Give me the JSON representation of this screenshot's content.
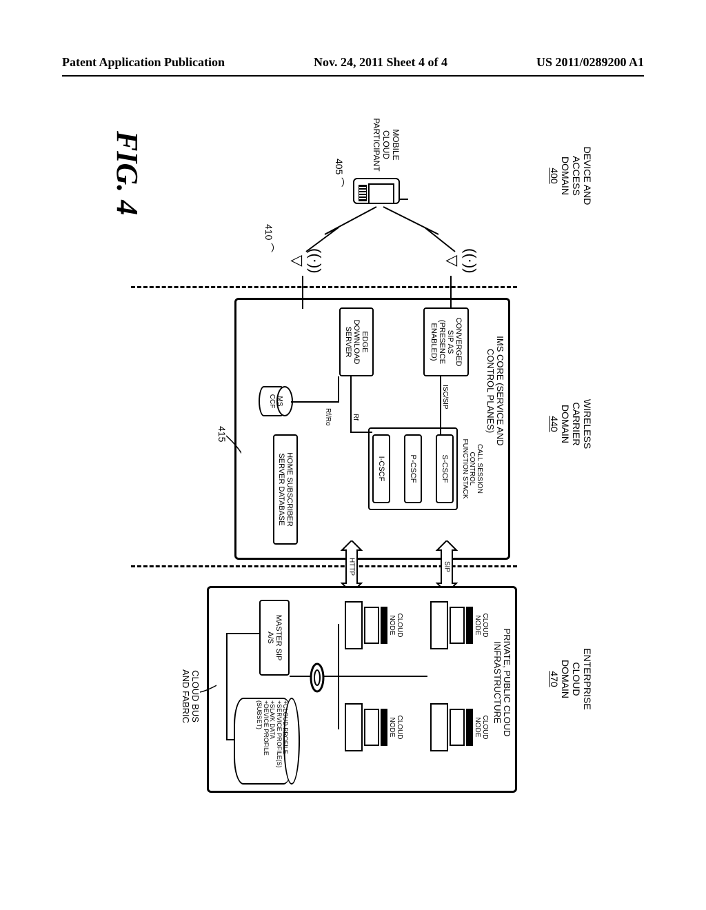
{
  "header": {
    "left": "Patent Application Publication",
    "center": "Nov. 24, 2011  Sheet 4 of 4",
    "right": "US 2011/0289200 A1"
  },
  "figure_label": "FIG. 4",
  "domains": {
    "device": {
      "title": "DEVICE AND\nACCESS\nDOMAIN",
      "ref": "400"
    },
    "carrier": {
      "title": "WIRELESS\nCARRIER\nDOMAIN",
      "ref": "440"
    },
    "enterprise": {
      "title": "ENTERPRISE\nCLOUD\nDOMAIN",
      "ref": "470"
    }
  },
  "device_domain": {
    "participant_label": "MOBILE\nCLOUD\nPARTICIPANT",
    "phone_ref": "405",
    "tower_ref": "410",
    "carrier_ref": "415"
  },
  "carrier_domain": {
    "panel_title": "IMS CORE (SERVICE AND\nCONTROL PLANES)",
    "converged": "CONVERGED\nSIP AS\n(PRESENCE\nENABLED)",
    "edge": "EDGE\nDOWNLOAD\nSERVER",
    "callstack_title": "CALL SESSION\nCONTROL\nFUNCTION STACK",
    "scscf": "S-CSCF",
    "pcscf": "P-CSCF",
    "icscf": "I-CSCF",
    "hss": "HOME SUBSCRIBER\nSERVER DATABASE",
    "msccf": "MS\nCCF",
    "isc": "ISC/SIP",
    "rf": "Rf",
    "rfro": "Rf/Ro"
  },
  "interarrows": {
    "sip": "SIP",
    "http": "HTTP"
  },
  "enterprise_domain": {
    "panel_title": "PRIVATE, PUBLIC CLOUD\nINFRASTRUCTURE",
    "cloud_node": "CLOUD\nNODE",
    "master": "MASTER SIP\nA/S",
    "db_lines": "+CLOUD PROFILE\n+SERVICE PROFILE(S)\n+SLA/K DATA\n+DEVICE PROFILE\n(SUBSET)",
    "bus": "CLOUD BUS\nAND FABRIC"
  },
  "chart_data": {
    "type": "diagram",
    "note": "Architecture block diagram; no quantitative data series."
  }
}
